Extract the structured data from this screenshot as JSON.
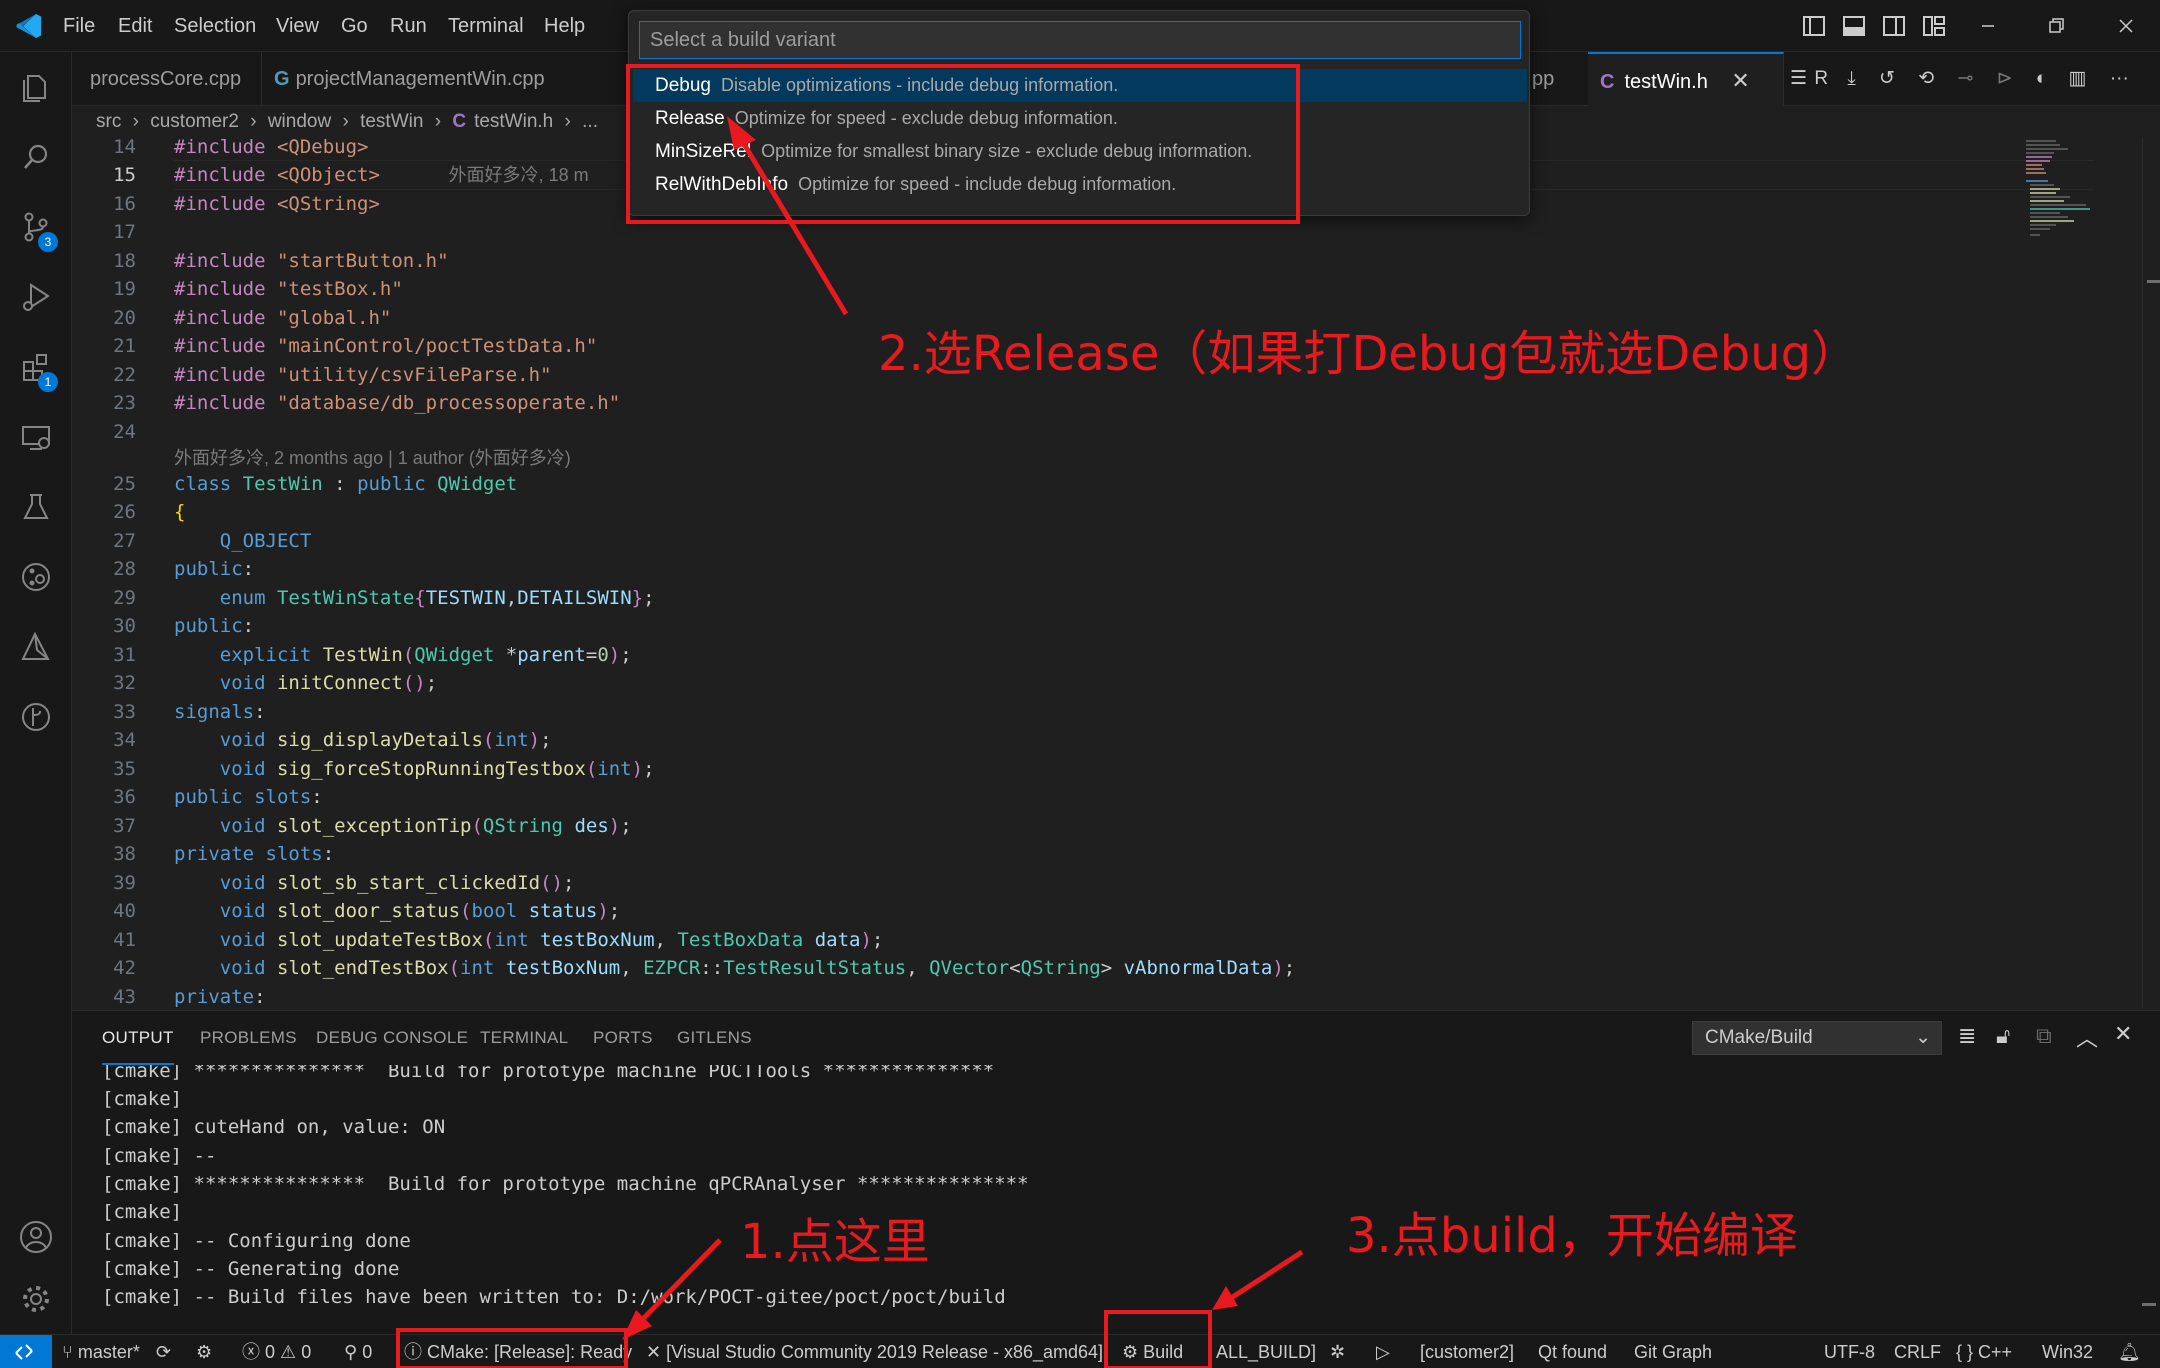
{
  "menu": [
    "File",
    "Edit",
    "Selection",
    "View",
    "Go",
    "Run",
    "Terminal",
    "Help"
  ],
  "tabs": [
    {
      "label": "processCore.cpp",
      "icon": ""
    },
    {
      "label": "projectManagementWin.cpp",
      "icon": "G"
    },
    {
      "label": "pp",
      "icon": ""
    },
    {
      "label": "testWin.h",
      "icon": "C"
    }
  ],
  "tab_toolbar_text": "R",
  "breadcrumb": [
    "src",
    "customer2",
    "window",
    "testWin",
    "testWin.h",
    "..."
  ],
  "breadcrumb_file_icon": "C",
  "quickpick": {
    "placeholder": "Select a build variant",
    "items": [
      {
        "label": "Debug",
        "desc": "Disable optimizations - include debug information."
      },
      {
        "label": "Release",
        "desc": "Optimize for speed - exclude debug information."
      },
      {
        "label": "MinSizeRel",
        "desc": "Optimize for smallest binary size - exclude debug information."
      },
      {
        "label": "RelWithDebInfo",
        "desc": "Optimize for speed - include debug information."
      }
    ]
  },
  "editor": {
    "current_line": "15",
    "inline_blame": "外面好多冷, 18 m",
    "codelens_blame": "外面好多冷, 2 months ago | 1 author (外面好多冷)",
    "line_numbers": [
      "14",
      "15",
      "16",
      "17",
      "18",
      "19",
      "20",
      "21",
      "22",
      "23",
      "24",
      "25",
      "26",
      "27",
      "28",
      "29",
      "30",
      "31",
      "32",
      "33",
      "34",
      "35",
      "36",
      "37",
      "38",
      "39",
      "40",
      "41",
      "42",
      "43"
    ]
  },
  "panel": {
    "tabs": [
      "OUTPUT",
      "PROBLEMS",
      "DEBUG CONSOLE",
      "TERMINAL",
      "PORTS",
      "GITLENS"
    ],
    "active_tab": "OUTPUT",
    "channel": "CMake/Build",
    "lines": [
      "[cmake] ***************  Build for prototype machine POCTTools ***************",
      "[cmake]",
      "[cmake] cuteHand on, value: ON",
      "[cmake] --",
      "[cmake] ***************  Build for prototype machine qPCRAnalyser ***************",
      "[cmake]",
      "[cmake] -- Configuring done",
      "[cmake] -- Generating done",
      "[cmake] -- Build files have been written to: D:/work/POCT-gitee/poct/poct/build"
    ]
  },
  "statusbar": {
    "branch": "master*",
    "errors": "0",
    "warnings": "0",
    "ports": "0",
    "cmake_status": "CMake: [Release]: Ready",
    "kit": "[Visual Studio Community 2019 Release - x86_amd64]",
    "build": "Build",
    "target": "ALL_BUILD]",
    "project": "[customer2]",
    "qt": "Qt found",
    "git_graph": "Git Graph",
    "encoding": "UTF-8",
    "eol": "CRLF",
    "lang_braces": "{ }",
    "language": "C++",
    "platform": "Win32"
  },
  "annotations": {
    "step1": "1.点这里",
    "step2": "2.选Release（如果打Debug包就选Debug）",
    "step3": "3.点build，开始编译"
  },
  "colors": {
    "accent": "#0078d4",
    "annotation_red": "#e8191f",
    "background": "#1f1f1f"
  }
}
